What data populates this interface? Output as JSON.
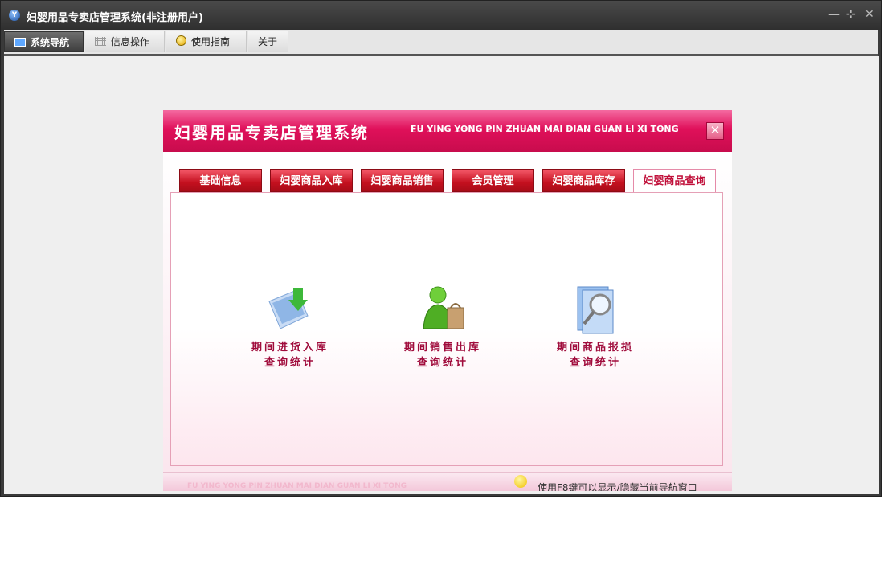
{
  "window": {
    "title": "妇婴用品专卖店管理系统(非注册用户)",
    "controls": {
      "minimize": "—",
      "restore": "⊹",
      "close": "✕"
    }
  },
  "menubar": {
    "items": [
      {
        "label": "系统导航",
        "icon": "monitor-icon",
        "active": true
      },
      {
        "label": "信息操作",
        "icon": "grid-icon",
        "active": false
      },
      {
        "label": "使用指南",
        "icon": "help-icon",
        "active": false
      },
      {
        "label": "关于",
        "icon": "",
        "active": false
      }
    ]
  },
  "panel": {
    "title_cn": "妇婴用品专卖店管理系统",
    "title_en": "FU YING YONG PIN ZHUAN MAI DIAN GUAN LI XI TONG",
    "close_label": "✕",
    "tabs": [
      {
        "label": "基础信息",
        "active": false
      },
      {
        "label": "妇婴商品入库",
        "active": false
      },
      {
        "label": "妇婴商品销售",
        "active": false
      },
      {
        "label": "会员管理",
        "active": false
      },
      {
        "label": "妇婴商品库存",
        "active": false
      },
      {
        "label": "妇婴商品查询",
        "active": true
      }
    ],
    "query_items": [
      {
        "label": "期间进货入库\n查询统计",
        "icon": "import-document-icon"
      },
      {
        "label": "期间销售出库\n查询统计",
        "icon": "shopper-icon"
      },
      {
        "label": "期间商品报损\n查询统计",
        "icon": "magnifier-icon"
      }
    ],
    "footer_en": "FU YING YONG PIN ZHUAN MAI DIAN GUAN LI XI TONG",
    "footer_tip": "使用F8键可以显示/隐藏当前导航窗口"
  },
  "colors": {
    "accent": "#e0105a",
    "tab_red": "#c4101f",
    "label_red": "#a00c3c"
  }
}
